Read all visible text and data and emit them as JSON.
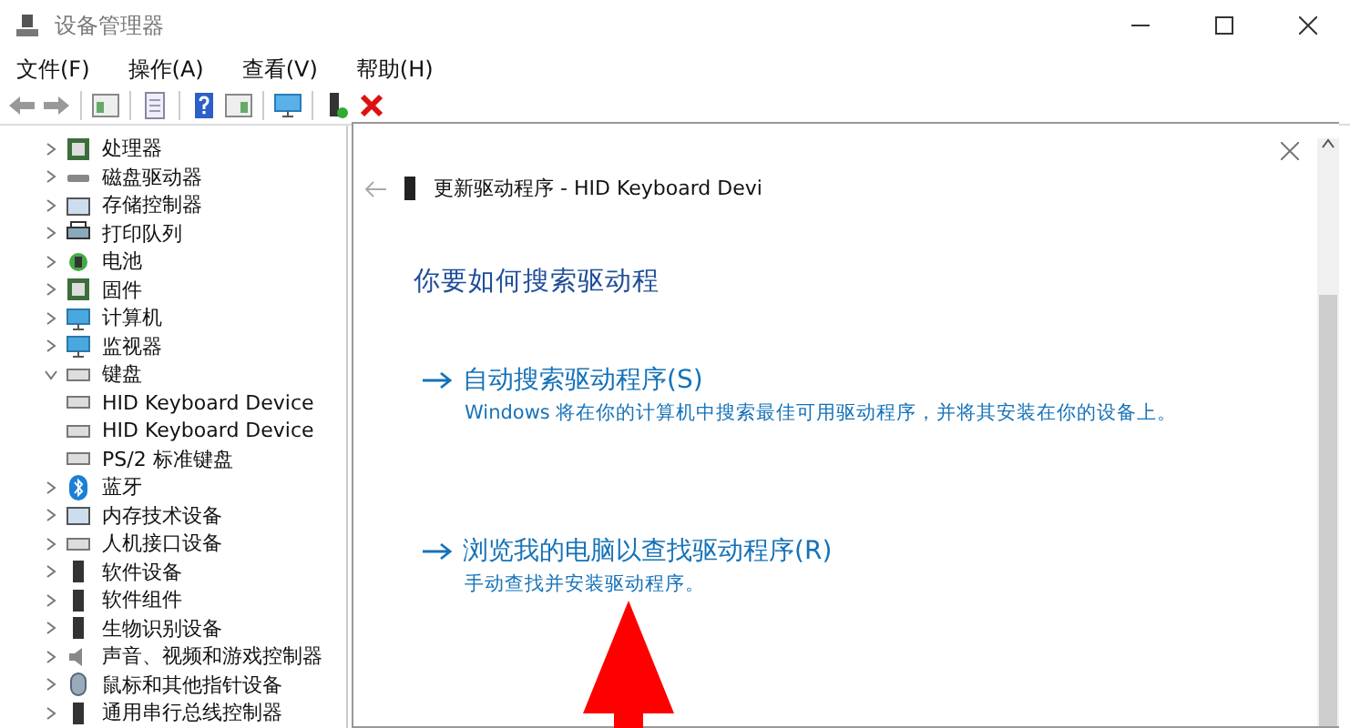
{
  "window": {
    "title": "设备管理器"
  },
  "menu": [
    "文件(F)",
    "操作(A)",
    "查看(V)",
    "帮助(H)"
  ],
  "tree": [
    {
      "label": "处理器",
      "kind": "chip",
      "expanded": false
    },
    {
      "label": "磁盘驱动器",
      "kind": "disk",
      "expanded": false
    },
    {
      "label": "存储控制器",
      "kind": "storage",
      "expanded": false
    },
    {
      "label": "打印队列",
      "kind": "printer",
      "expanded": false
    },
    {
      "label": "电池",
      "kind": "battery",
      "expanded": false
    },
    {
      "label": "固件",
      "kind": "chip",
      "expanded": false
    },
    {
      "label": "计算机",
      "kind": "monitor",
      "expanded": false
    },
    {
      "label": "监视器",
      "kind": "monitor",
      "expanded": false
    },
    {
      "label": "键盘",
      "kind": "keyboard",
      "expanded": true,
      "children": [
        {
          "label": "HID Keyboard Device",
          "kind": "keyboard"
        },
        {
          "label": "HID Keyboard Device",
          "kind": "keyboard"
        },
        {
          "label": "PS/2 标准键盘",
          "kind": "keyboard"
        }
      ]
    },
    {
      "label": "蓝牙",
      "kind": "bluetooth",
      "expanded": false
    },
    {
      "label": "内存技术设备",
      "kind": "storage",
      "expanded": false
    },
    {
      "label": "人机接口设备",
      "kind": "keyboard",
      "expanded": false
    },
    {
      "label": "软件设备",
      "kind": "device",
      "expanded": false
    },
    {
      "label": "软件组件",
      "kind": "device",
      "expanded": false
    },
    {
      "label": "生物识别设备",
      "kind": "device",
      "expanded": false
    },
    {
      "label": "声音、视频和游戏控制器",
      "kind": "speaker",
      "expanded": false
    },
    {
      "label": "鼠标和其他指针设备",
      "kind": "mouse",
      "expanded": false
    },
    {
      "label": "通用串行总线控制器",
      "kind": "device",
      "expanded": false
    }
  ],
  "dialog": {
    "title": "更新驱动程序 - HID Keyboard Devi",
    "heading": "你要如何搜索驱动程",
    "options": [
      {
        "label": "自动搜索驱动程序(S)",
        "description": "Windows 将在你的计算机中搜索最佳可用驱动程序，并将其安装在你的设备上。"
      },
      {
        "label": "浏览我的电脑以查找驱动程序(R)",
        "description": "手动查找并安装驱动程序。"
      }
    ]
  }
}
